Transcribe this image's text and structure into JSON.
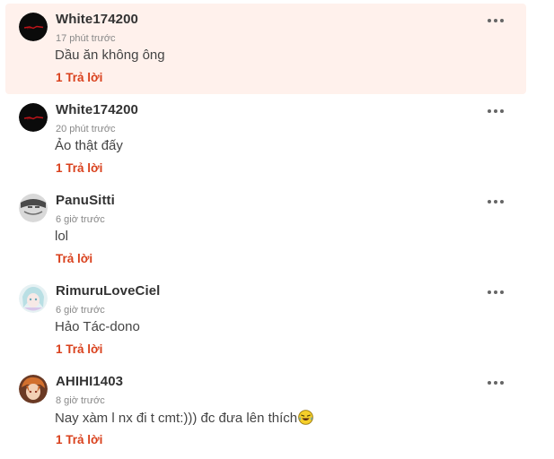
{
  "comments": [
    {
      "username": "White174200",
      "time": "17 phút trước",
      "text": "Dầu ăn không ông",
      "reply": "1 Trả lời",
      "avatar": "dark-red-streak-avatar",
      "highlighted": true
    },
    {
      "username": "White174200",
      "time": "20 phút trước",
      "text": "Ảo thật đấy",
      "reply": "1 Trả lời",
      "avatar": "dark-red-streak-avatar"
    },
    {
      "username": "PanuSitti",
      "time": "6 giờ trước",
      "text": "lol",
      "reply": "Trả lời",
      "avatar": "grey-manga-avatar"
    },
    {
      "username": "RimuruLoveCiel",
      "time": "6 giờ trước",
      "text": "Hảo Tác-dono",
      "reply": "1 Trả lời",
      "avatar": "anime-girl-avatar"
    },
    {
      "username": "AHIHI1403",
      "time": "8 giờ trước",
      "text": "Nay xàm l nx đi t cmt:))) đc đưa lên thích",
      "reply": "1 Trả lời",
      "avatar": "orange-hair-avatar",
      "emoji": "laughing-emoji"
    }
  ],
  "colors": {
    "highlight_bg": "#fff1ec",
    "reply_link": "#d9401c",
    "username": "#333333",
    "time": "#888888"
  }
}
